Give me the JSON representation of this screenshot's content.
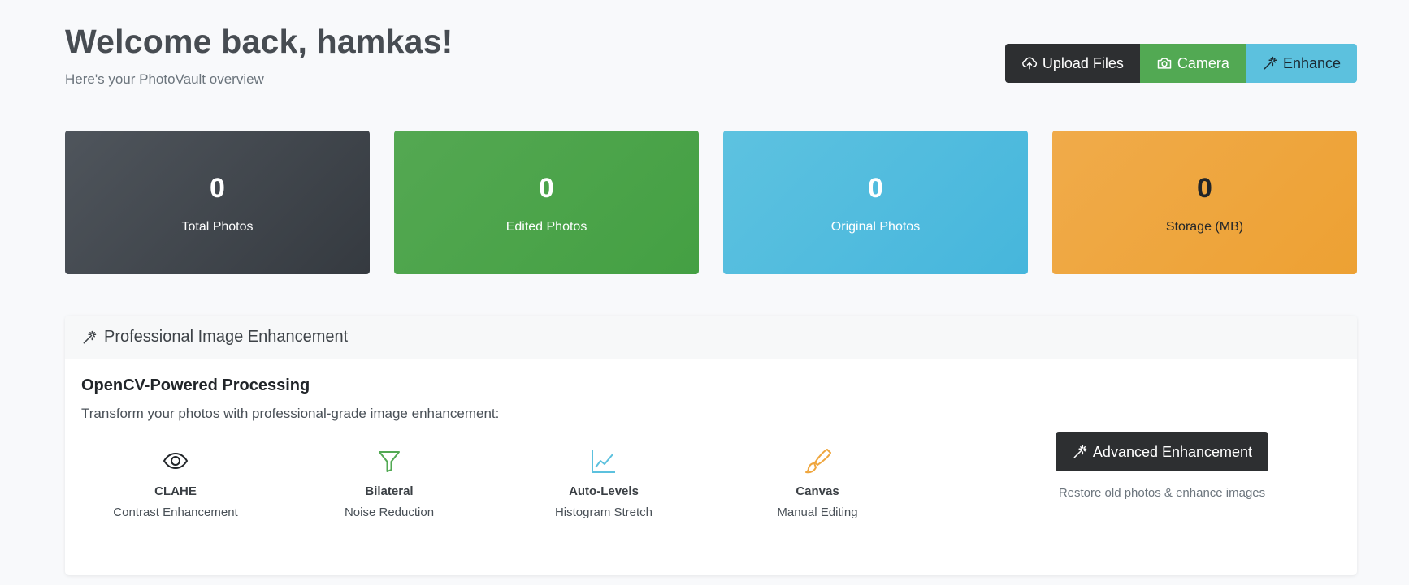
{
  "header": {
    "title": "Welcome back, hamkas!",
    "subtitle": "Here's your PhotoVault overview",
    "actions": [
      {
        "label": "Upload Files",
        "icon": "cloud-upload-icon"
      },
      {
        "label": "Camera",
        "icon": "camera-icon"
      },
      {
        "label": "Enhance",
        "icon": "magic-wand-icon"
      }
    ]
  },
  "stats": [
    {
      "value": "0",
      "label": "Total Photos",
      "color": "#3f444a"
    },
    {
      "value": "0",
      "label": "Edited Photos",
      "color": "#4ca64b"
    },
    {
      "value": "0",
      "label": "Original Photos",
      "color": "#52bde0"
    },
    {
      "value": "0",
      "label": "Storage (MB)",
      "color": "#efa63e"
    }
  ],
  "enhancement": {
    "header": "Professional Image Enhancement",
    "title": "OpenCV-Powered Processing",
    "description": "Transform your photos with professional-grade image enhancement:",
    "features": [
      {
        "name": "CLAHE",
        "description": "Contrast Enhancement",
        "icon": "eye-icon",
        "color": "#212529"
      },
      {
        "name": "Bilateral",
        "description": "Noise Reduction",
        "icon": "filter-icon",
        "color": "#52a953"
      },
      {
        "name": "Auto-Levels",
        "description": "Histogram Stretch",
        "icon": "line-chart-icon",
        "color": "#5cc1de"
      },
      {
        "name": "Canvas",
        "description": "Manual Editing",
        "icon": "brush-icon",
        "color": "#efa63e"
      }
    ],
    "cta": {
      "label": "Advanced Enhancement",
      "note": "Restore old photos & enhance images"
    }
  }
}
